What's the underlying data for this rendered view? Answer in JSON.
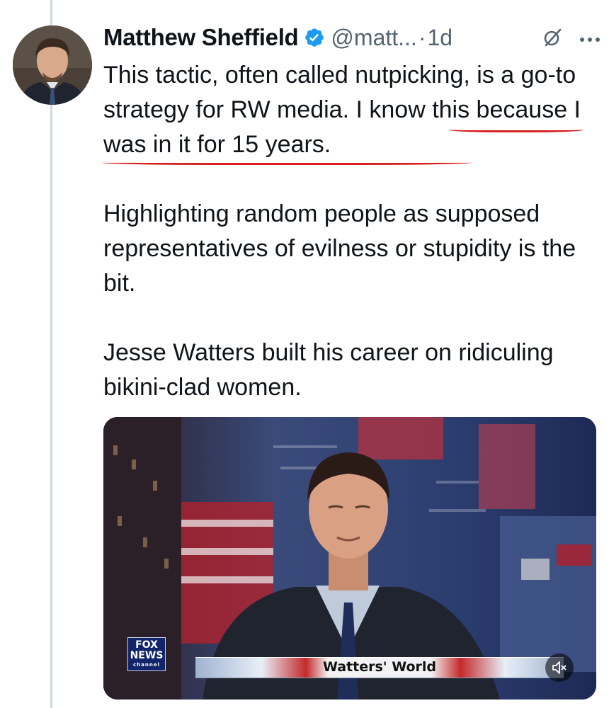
{
  "tweet": {
    "author_name": "Matthew Sheffield",
    "handle": "@matt...",
    "separator": "·",
    "time": "1d",
    "paragraphs": [
      "This tactic, often called nutpicking, is a go-to strategy for RW media. I know this because I was in it for 15 years.",
      "Highlighting random people as supposed representatives of evilness or stupidity is the bit.",
      "Jesse Watters built his career on ridiculing bikini-clad women."
    ],
    "icons": {
      "verified": "verified-badge-icon",
      "grok": "grok-icon",
      "more": "more-options-icon",
      "mute": "volume-muted-icon"
    },
    "colors": {
      "verified": "#1d9bf0",
      "annotation_underline": "#d6201f",
      "secondary_text": "#536471"
    }
  },
  "video": {
    "lower_third": "Watters' World",
    "network_logo_line1": "FOX",
    "network_logo_line2": "NEWS",
    "network_logo_line3": "channel"
  }
}
